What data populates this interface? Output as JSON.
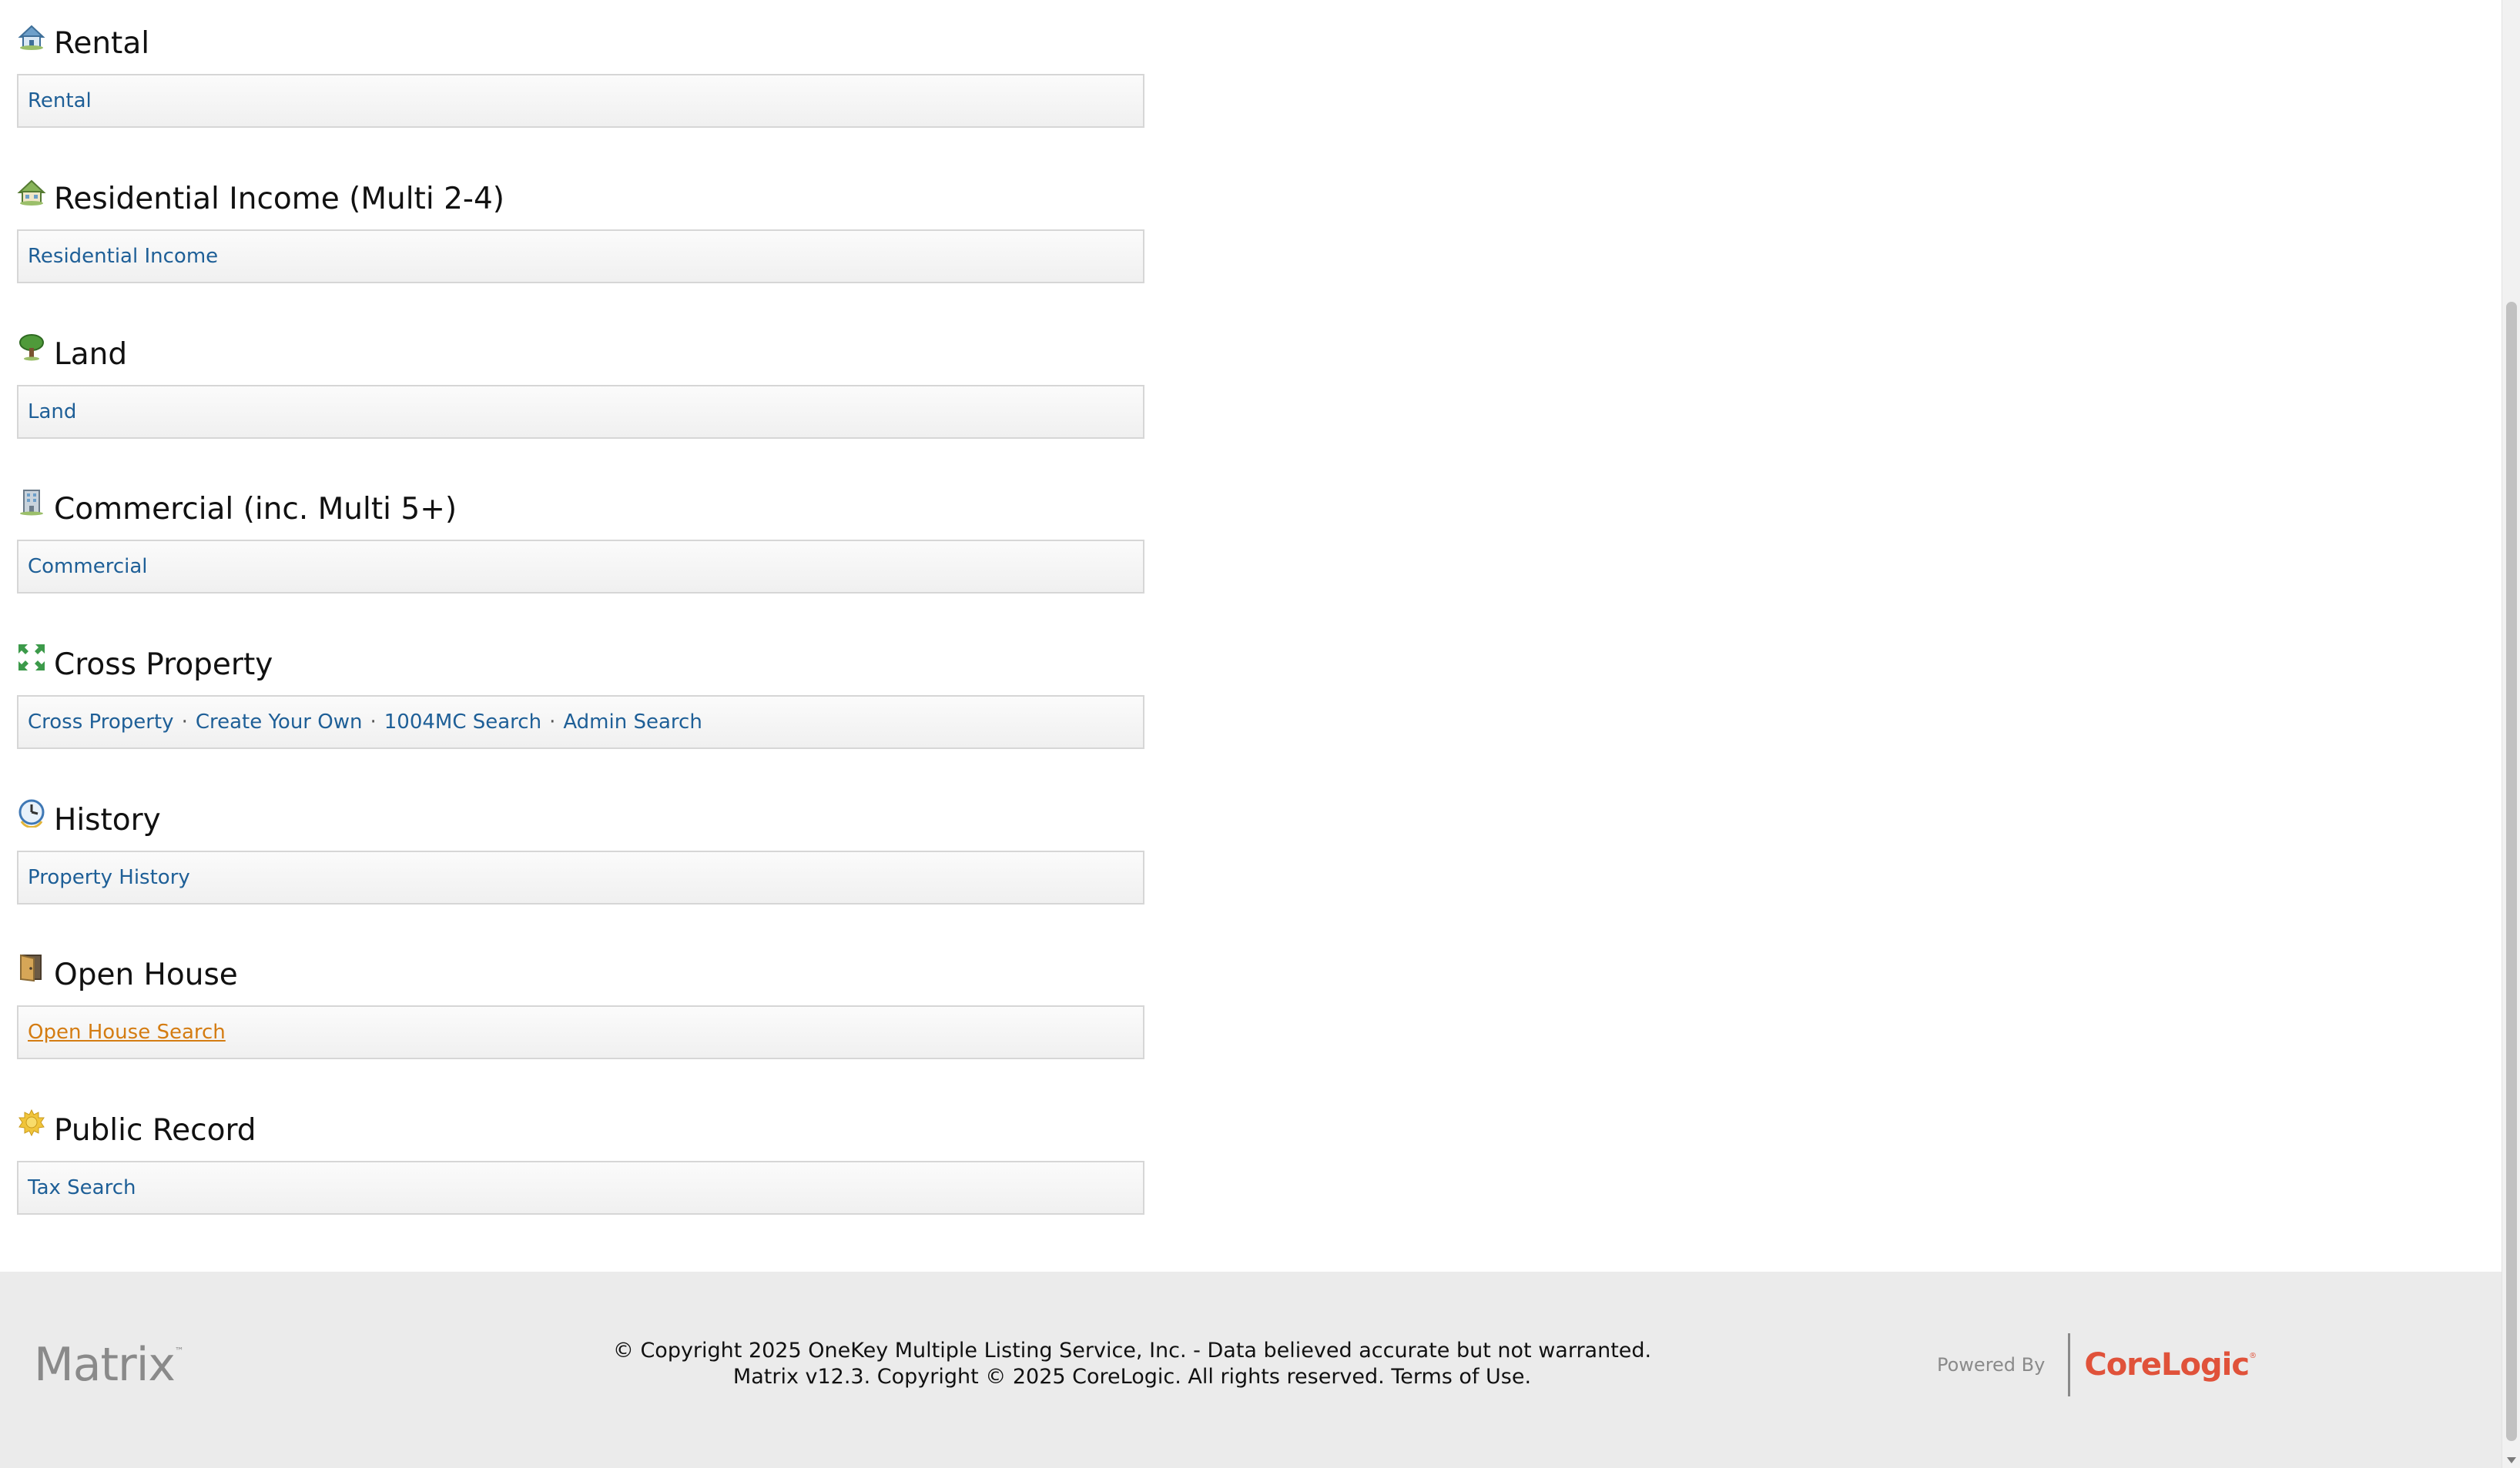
{
  "sections": [
    {
      "title": "Rental",
      "icon": "rental-house-icon",
      "links": [
        "Rental"
      ]
    },
    {
      "title": "Residential Income (Multi 2-4)",
      "icon": "residential-income-house-icon",
      "links": [
        "Residential Income"
      ]
    },
    {
      "title": "Land",
      "icon": "tree-icon",
      "links": [
        "Land"
      ]
    },
    {
      "title": "Commercial (inc. Multi 5+)",
      "icon": "building-icon",
      "links": [
        "Commercial"
      ]
    },
    {
      "title": "Cross Property",
      "icon": "cross-property-arrows-icon",
      "links": [
        "Cross Property",
        "Create Your Own",
        "1004MC Search",
        "Admin Search"
      ]
    },
    {
      "title": "History",
      "icon": "clock-icon",
      "links": [
        "Property History"
      ]
    },
    {
      "title": "Open House",
      "icon": "open-door-icon",
      "links": [
        "Open House Search"
      ]
    },
    {
      "title": "Public Record",
      "icon": "seal-icon",
      "links": [
        "Tax Search"
      ]
    }
  ],
  "link_separator": "·",
  "footer": {
    "logo": "Matrix",
    "logo_tm": "™",
    "copyright_line1": "© Copyright 2025 OneKey Multiple Listing Service, Inc. - Data believed accurate but not warranted.",
    "copyright_line2": "Matrix v12.3. Copyright © 2025 CoreLogic. All rights reserved.",
    "terms_link": "Terms of Use.",
    "powered_by": "Powered By",
    "brand": "CoreLogic",
    "brand_mark": "®"
  },
  "colors": {
    "link": "#1e5f97",
    "link_hover": "#d47c12",
    "brand": "#e0523a",
    "footer_bg": "#ebebeb"
  }
}
